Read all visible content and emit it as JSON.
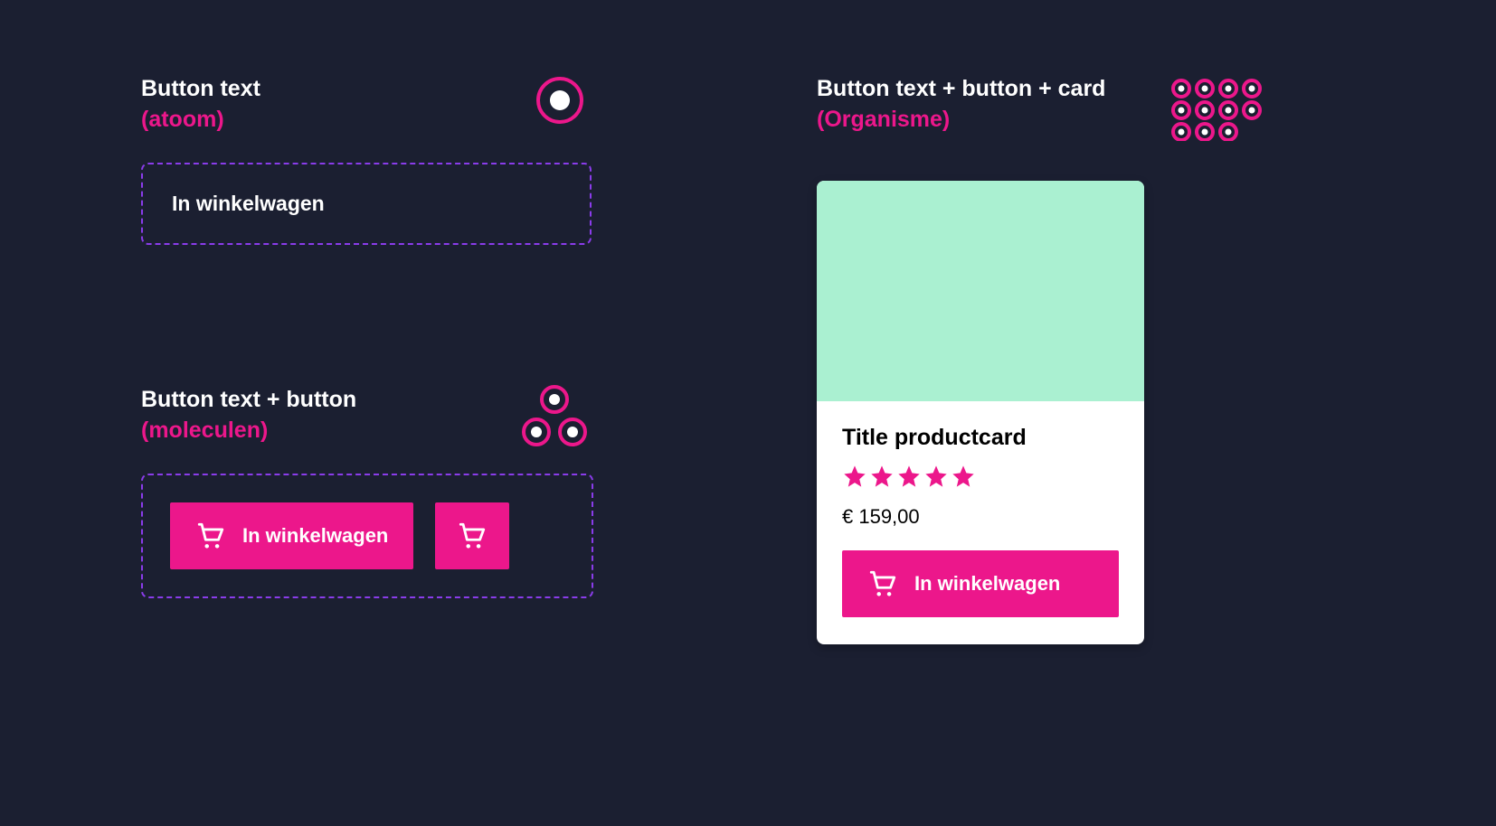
{
  "atom": {
    "title": "Button text",
    "subtitle": "(atoom)",
    "label": "In winkelwagen"
  },
  "molecule": {
    "title": "Button text + button",
    "subtitle": "(moleculen)",
    "button_label": "In winkelwagen"
  },
  "organism": {
    "title": "Button text + button + card",
    "subtitle": "(Organisme)",
    "card": {
      "title": "Title productcard",
      "price": "€ 159,00",
      "rating": 5,
      "button_label": "In winkelwagen"
    }
  },
  "colors": {
    "background": "#1b1f31",
    "accent": "#ec178b",
    "dashed_border": "#8a3cea",
    "card_image_bg": "#aaf0d1"
  }
}
